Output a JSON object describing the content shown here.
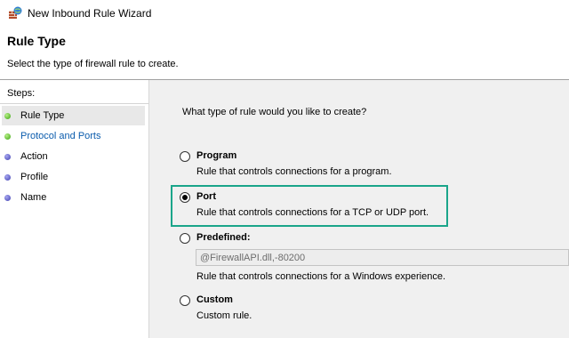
{
  "window": {
    "title": "New Inbound Rule Wizard",
    "icon": "firewall-icon"
  },
  "header": {
    "title": "Rule Type",
    "description": "Select the type of firewall rule to create."
  },
  "steps": {
    "heading": "Steps:",
    "items": [
      {
        "label": "Rule Type",
        "status": "current"
      },
      {
        "label": "Protocol and Ports",
        "status": "link"
      },
      {
        "label": "Action",
        "status": "pending"
      },
      {
        "label": "Profile",
        "status": "pending"
      },
      {
        "label": "Name",
        "status": "pending"
      }
    ]
  },
  "content": {
    "question": "What type of rule would you like to create?",
    "options": [
      {
        "title": "Program",
        "description": "Rule that controls connections for a program.",
        "selected": false
      },
      {
        "title": "Port",
        "description": "Rule that controls connections for a TCP or UDP port.",
        "selected": true
      },
      {
        "title": "Predefined:",
        "description": "Rule that controls connections for a Windows experience.",
        "selected": false
      },
      {
        "title": "Custom",
        "description": "Custom rule.",
        "selected": false
      }
    ],
    "predefined_value": "@FirewallAPI.dll,-80200"
  },
  "colors": {
    "highlight": "#1aa58a",
    "link": "#0b5cad",
    "step_current_dot": "#3aa30e",
    "step_pending_dot": "#3e3eb0"
  }
}
